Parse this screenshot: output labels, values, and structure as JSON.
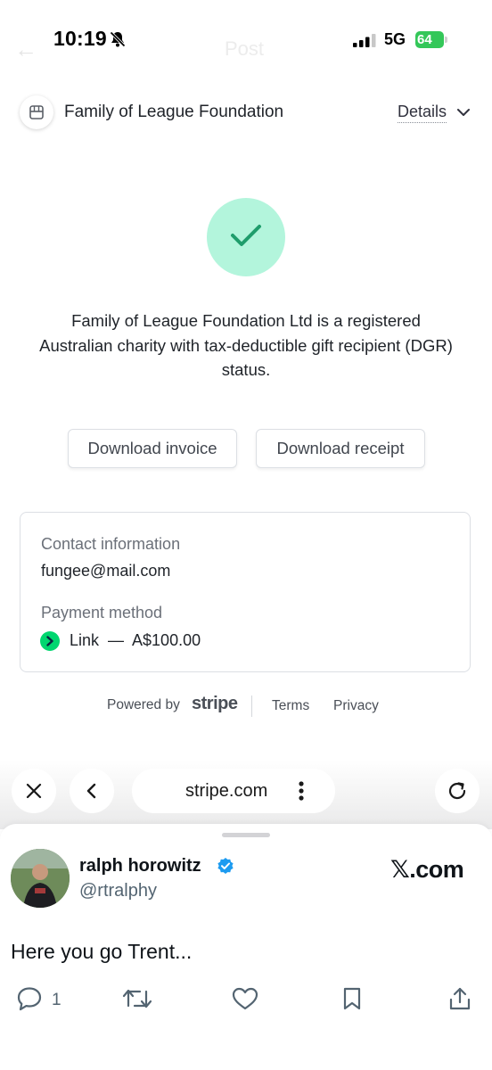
{
  "status_bar": {
    "time": "10:19",
    "network": "5G",
    "battery": "64",
    "bg_back_hint": "←",
    "bg_title_hint": "Post"
  },
  "merchant": {
    "name": "Family of League Foundation",
    "details_label": "Details"
  },
  "confirmation": {
    "line1": "Family of League Foundation Ltd is a registered",
    "line2": "Australian charity with tax-deductible gift recipient (DGR)",
    "line3": "status."
  },
  "buttons": {
    "download_invoice": "Download invoice",
    "download_receipt": "Download receipt"
  },
  "info_card": {
    "contact_label": "Contact information",
    "contact_value": "fungee@mail.com",
    "payment_label": "Payment method",
    "payment_method": "Link  —  A$100.00"
  },
  "footer": {
    "powered_by": "Powered by",
    "brand": "stripe",
    "terms": "Terms",
    "privacy": "Privacy"
  },
  "browser": {
    "url": "stripe.com"
  },
  "tweet": {
    "author_name": "ralph horowitz",
    "handle": "@rtralphy",
    "site": "𝕏.com",
    "text": "Here you go Trent...",
    "reply_count": "1"
  },
  "colors": {
    "success_bg": "#b3f5dc",
    "success_check": "#1f9d6c",
    "link_green": "#00d66f",
    "verified_blue": "#1d9bf0",
    "battery_green": "#34c759"
  }
}
